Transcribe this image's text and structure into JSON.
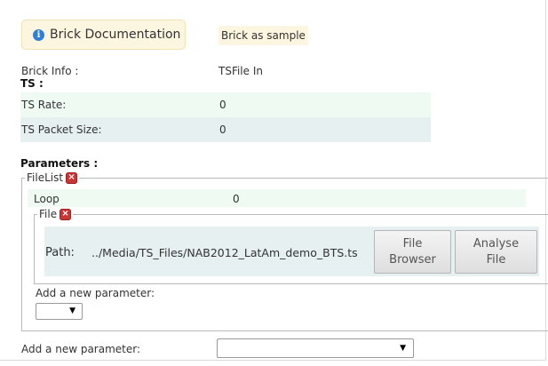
{
  "header": {
    "doc_button": "Brick Documentation",
    "sample_button": "Brick as sample"
  },
  "brick_info": {
    "label": "Brick Info :",
    "value": "TSFile In"
  },
  "ts": {
    "heading": "TS :",
    "rows": [
      {
        "label": "TS Rate:",
        "value": "0"
      },
      {
        "label": "TS Packet Size:",
        "value": "0"
      }
    ]
  },
  "parameters": {
    "heading": "Parameters :",
    "filelist": {
      "legend": "FileList",
      "loop_label": "Loop",
      "loop_value": "0",
      "file": {
        "legend": "File",
        "path_label": "Path:",
        "path_value": "../Media/TS_Files/NAB2012_LatAm_demo_BTS.ts",
        "file_browser_line1": "File",
        "file_browser_line2": "Browser",
        "analyse_line1": "Analyse",
        "analyse_line2": "File"
      },
      "add_param_label": "Add a new parameter:",
      "add_param_value": ""
    },
    "add_param_label": "Add a new parameter:",
    "add_param_value": ""
  },
  "colors": {
    "doc_button_bg": "#fcf5df",
    "info_icon": "#2f7ed8",
    "remove_icon": "#c93535",
    "band_green": "#effaf3",
    "band_blue": "#e6f0f1"
  },
  "icons": {
    "info": "info-circle-icon",
    "remove": "close-box-icon",
    "dropdown": "caret-down-icon"
  }
}
